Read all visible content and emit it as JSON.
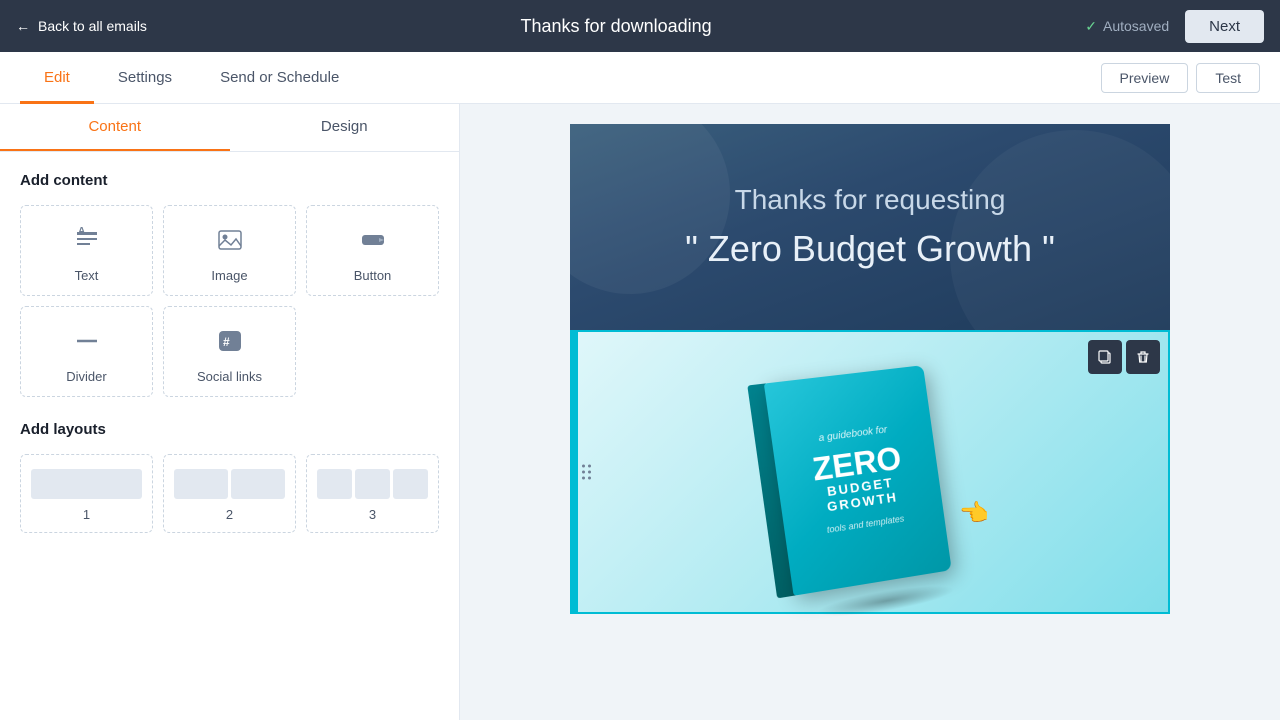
{
  "topBar": {
    "backLabel": "Back to all emails",
    "title": "Thanks for downloading",
    "autosaved": "Autosaved",
    "nextLabel": "Next"
  },
  "secondaryNav": {
    "tabs": [
      {
        "id": "edit",
        "label": "Edit",
        "active": true
      },
      {
        "id": "settings",
        "label": "Settings",
        "active": false
      },
      {
        "id": "send-schedule",
        "label": "Send or Schedule",
        "active": false
      }
    ],
    "previewLabel": "Preview",
    "testLabel": "Test"
  },
  "sidebar": {
    "tabs": [
      {
        "id": "content",
        "label": "Content",
        "active": true
      },
      {
        "id": "design",
        "label": "Design",
        "active": false
      }
    ],
    "addContent": {
      "title": "Add content",
      "items": [
        {
          "id": "text",
          "label": "Text",
          "icon": "Ā"
        },
        {
          "id": "image",
          "label": "Image",
          "icon": "🖼"
        },
        {
          "id": "button",
          "label": "Button",
          "icon": "▬"
        },
        {
          "id": "divider",
          "label": "Divider",
          "icon": "—"
        },
        {
          "id": "social-links",
          "label": "Social links",
          "icon": "#"
        }
      ]
    },
    "addLayouts": {
      "title": "Add layouts",
      "items": [
        {
          "id": "1",
          "label": "1",
          "cols": 1
        },
        {
          "id": "2",
          "label": "2",
          "cols": 2
        },
        {
          "id": "3",
          "label": "3",
          "cols": 3
        }
      ]
    }
  },
  "emailCanvas": {
    "header": {
      "line1": "Thanks for requesting",
      "line2": "\" Zero Budget Growth \""
    },
    "imageSection": {
      "altText": "Zero Budget Growth book cover",
      "bookTitle": "ZERO",
      "bookSubtitle1": "BUDGET",
      "bookSubtitle2": "GROWTH",
      "bookGuidebook": "a guidebook for",
      "bookTools": "tools and templates"
    },
    "actionBar": {
      "copyTooltip": "Copy",
      "deleteTooltip": "Delete"
    }
  }
}
